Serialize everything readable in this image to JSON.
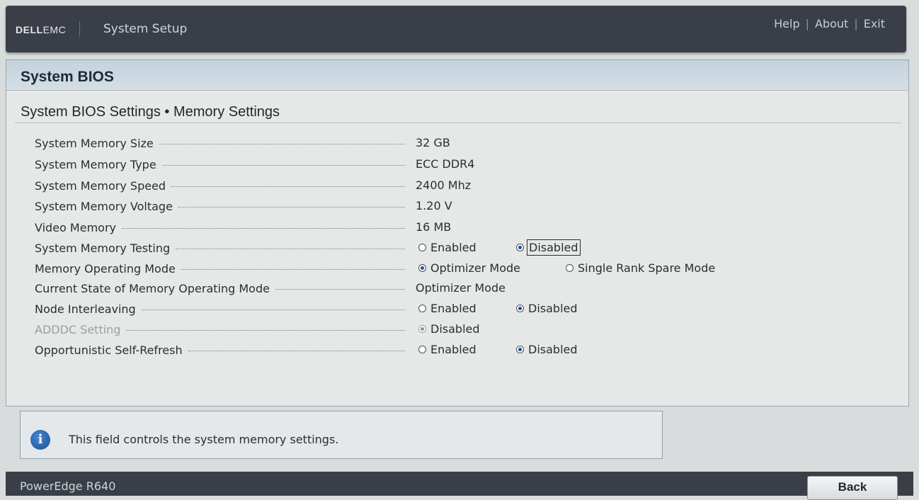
{
  "header": {
    "brand_bold": "DELL",
    "brand_light": "EMC",
    "title": "System Setup",
    "links": [
      "Help",
      "About",
      "Exit"
    ]
  },
  "panel": {
    "title": "System BIOS",
    "breadcrumb": "System BIOS Settings • Memory Settings"
  },
  "settings": [
    {
      "label": "System Memory Size",
      "value": "32 GB"
    },
    {
      "label": "System Memory Type",
      "value": "ECC DDR4"
    },
    {
      "label": "System Memory Speed",
      "value": "2400 Mhz"
    },
    {
      "label": "System Memory Voltage",
      "value": "1.20 V"
    },
    {
      "label": "Video Memory",
      "value": "16 MB"
    },
    {
      "label": "System Memory Testing",
      "options": [
        "Enabled",
        "Disabled"
      ],
      "selected": "Disabled",
      "focused": true
    },
    {
      "label": "Memory Operating Mode",
      "options": [
        "Optimizer Mode",
        "Single Rank Spare Mode"
      ],
      "selected": "Optimizer Mode"
    },
    {
      "label": "Current State of Memory Operating Mode",
      "value": "Optimizer Mode"
    },
    {
      "label": "Node Interleaving",
      "options": [
        "Enabled",
        "Disabled"
      ],
      "selected": "Disabled"
    },
    {
      "label": "ADDDC Setting",
      "options": [
        "Disabled"
      ],
      "selected": "Disabled",
      "disabled": true
    },
    {
      "label": "Opportunistic Self-Refresh",
      "options": [
        "Enabled",
        "Disabled"
      ],
      "selected": "Disabled"
    }
  ],
  "help": {
    "icon": "info-icon",
    "text": "This field controls the system memory settings."
  },
  "footer": {
    "model": "PowerEdge R640",
    "back_label": "Back"
  },
  "colors": {
    "header_bg": "#3a3e46",
    "panel_head": "#c9d5de",
    "radio_selected": "#1a4fa0"
  }
}
